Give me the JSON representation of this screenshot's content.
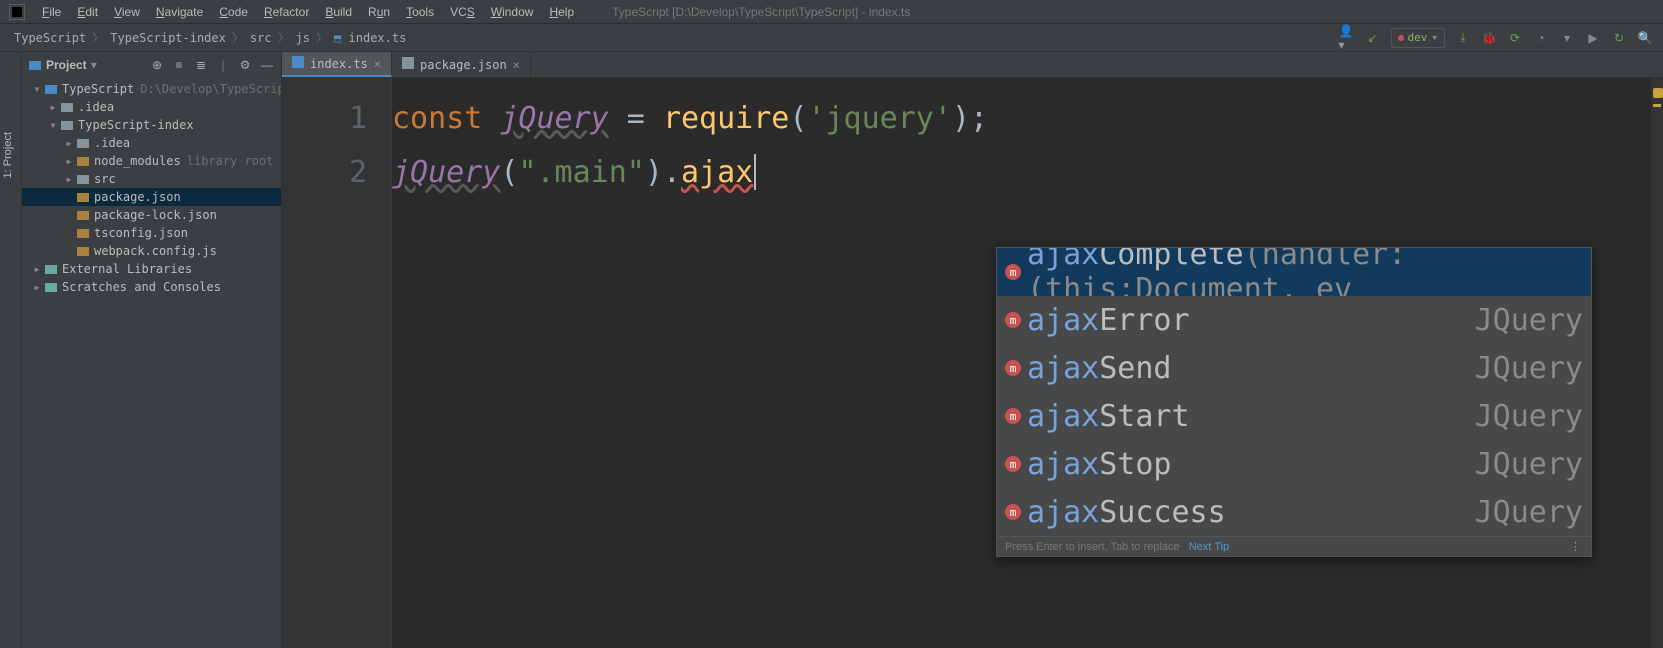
{
  "app": {
    "menu": [
      "File",
      "Edit",
      "View",
      "Navigate",
      "Code",
      "Refactor",
      "Build",
      "Run",
      "Tools",
      "VCS",
      "Window",
      "Help"
    ],
    "mnemonics": [
      "F",
      "E",
      "V",
      "N",
      "C",
      "R",
      "B",
      "u",
      "T",
      "S",
      "W",
      "H"
    ],
    "title_context": "TypeScript [D:\\Develop\\TypeScript\\TypeScript] - index.ts"
  },
  "breadcrumbs": [
    "TypeScript",
    "TypeScript-index",
    "src",
    "js",
    "index.ts"
  ],
  "run_config": {
    "name": "dev"
  },
  "tool_window": {
    "title": "Project",
    "side_label": "1: Project"
  },
  "tree": [
    {
      "depth": 1,
      "arrow": "▾",
      "icon": "project",
      "label": "TypeScript",
      "hint": "D:\\Develop\\TypeScript\\TypeScript"
    },
    {
      "depth": 2,
      "arrow": "▸",
      "icon": "folder",
      "label": ".idea",
      "hint": ""
    },
    {
      "depth": 2,
      "arrow": "▾",
      "icon": "folder",
      "label": "TypeScript-index",
      "hint": ""
    },
    {
      "depth": 3,
      "arrow": "▸",
      "icon": "folder",
      "label": ".idea",
      "hint": ""
    },
    {
      "depth": 3,
      "arrow": "▸",
      "icon": "folder-lib",
      "label": "node_modules",
      "hint": "library root"
    },
    {
      "depth": 3,
      "arrow": "▸",
      "icon": "folder",
      "label": "src",
      "hint": ""
    },
    {
      "depth": 3,
      "arrow": "",
      "icon": "json",
      "label": "package.json",
      "hint": "",
      "sel": true
    },
    {
      "depth": 3,
      "arrow": "",
      "icon": "json",
      "label": "package-lock.json",
      "hint": ""
    },
    {
      "depth": 3,
      "arrow": "",
      "icon": "json",
      "label": "tsconfig.json",
      "hint": ""
    },
    {
      "depth": 3,
      "arrow": "",
      "icon": "js",
      "label": "webpack.config.js",
      "hint": ""
    },
    {
      "depth": 1,
      "arrow": "▸",
      "icon": "lib",
      "label": "External Libraries",
      "hint": ""
    },
    {
      "depth": 1,
      "arrow": "▸",
      "icon": "scratch",
      "label": "Scratches and Consoles",
      "hint": ""
    }
  ],
  "editor": {
    "tabs": [
      {
        "label": "index.ts",
        "active": true
      },
      {
        "label": "package.json",
        "active": false
      }
    ],
    "gutter": [
      "1",
      "2"
    ],
    "code": {
      "line1": {
        "kw": "const",
        "var": "jQuery",
        "eq": " = ",
        "fn": "require",
        "open": "(",
        "str": "'jquery'",
        "close": ");"
      },
      "line2": {
        "var": "jQuery",
        "open": "(",
        "str": "\".main\"",
        "close": ").",
        "call": "ajax"
      }
    }
  },
  "completion": {
    "items": [
      {
        "match": "ajax",
        "rest": "Complete",
        "sig": "(handler: (this:Document, ev",
        "type": ""
      },
      {
        "match": "ajax",
        "rest": "Error",
        "sig": "",
        "type": "JQuery<HTMLElem…"
      },
      {
        "match": "ajax",
        "rest": "Send",
        "sig": "",
        "type": "JQuery<HTMLEleme…"
      },
      {
        "match": "ajax",
        "rest": "Start",
        "sig": "",
        "type": "JQuery<HTMLElem…"
      },
      {
        "match": "ajax",
        "rest": "Stop",
        "sig": "",
        "type": "JQuery<HTMLEleme…"
      },
      {
        "match": "ajax",
        "rest": "Success",
        "sig": "",
        "type": "JQuery<HTMLEl…"
      }
    ],
    "footer_hint": "Press Enter to insert, Tab to replace",
    "footer_link": "Next Tip"
  }
}
